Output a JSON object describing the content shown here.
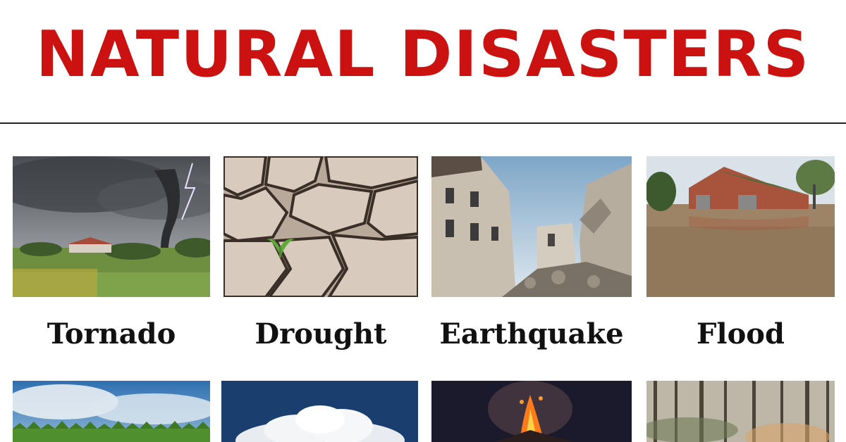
{
  "header": {
    "title": "NATURAL DISASTERS"
  },
  "row1": {
    "labels": [
      "Tornado",
      "Drought",
      "Earthquake",
      "Flood"
    ]
  },
  "images": {
    "tornado": "tornado-photo",
    "drought": "drought-photo",
    "earthquake": "earthquake-photo",
    "flood": "flood-photo",
    "storm": "storm-clouds-photo",
    "cloud": "cumulus-cloud-photo",
    "volcano": "volcano-eruption-photo",
    "wildfire": "smoky-forest-photo"
  },
  "colors": {
    "title": "#cc1111",
    "rule": "#222222",
    "label": "#111111"
  }
}
